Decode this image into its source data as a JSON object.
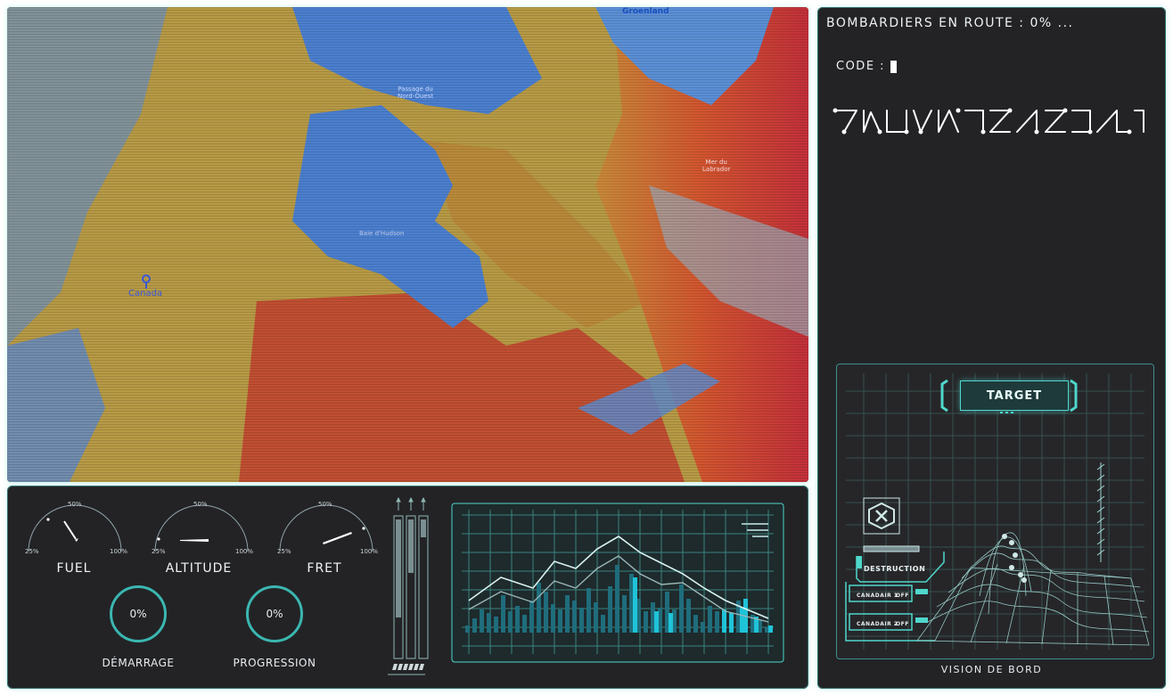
{
  "map": {
    "labels": {
      "greenland": "Groenland",
      "northwest_passage_1": "Passage du",
      "northwest_passage_2": "Nord-Ouest",
      "labrador_1": "Mer du",
      "labrador_2": "Labrador",
      "hudson": "Baie d'Hudson",
      "canada": "Canada"
    }
  },
  "gauges": [
    {
      "label": "FUEL",
      "min": "25%",
      "mid": "50%",
      "max": "100%",
      "level": 0.45
    },
    {
      "label": "ALTITUDE",
      "min": "25%",
      "mid": "50%",
      "max": "100%",
      "level": 0.25
    },
    {
      "label": "FRET",
      "min": "25%",
      "mid": "50%",
      "max": "100%",
      "level": 0.83
    }
  ],
  "rings": [
    {
      "label": "DÉMARRAGE",
      "value": "0%"
    },
    {
      "label": "PROGRESSION",
      "value": "0%"
    }
  ],
  "right": {
    "status": "BOMBARDIERS EN ROUTE : 0% ...",
    "code_label": "CODE :",
    "target_label": "TARGET",
    "destruction_label": "DESTRUCTION",
    "canadair1": "CANADAIR 1",
    "canadair2": "CANADAIR 2",
    "off1": "OFF",
    "off2": "OFF",
    "vision_label": "VISION DE BORD"
  },
  "colors": {
    "accent": "#4fd7cc",
    "panel": "#232326",
    "map_water": "#4b7fcf",
    "map_land_hot": "#c8402f",
    "map_land_mid": "#c9a23a"
  }
}
